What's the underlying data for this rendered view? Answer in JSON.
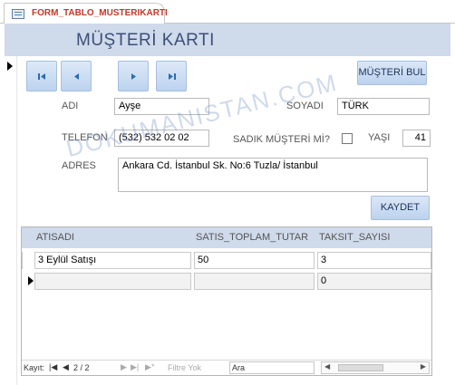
{
  "tab": {
    "title": "FORM_TABLO_MUSTERIKARTI"
  },
  "form": {
    "title": "MÜŞTERİ KARTI"
  },
  "buttons": {
    "find": "MÜŞTERİ BUL",
    "save": "KAYDET"
  },
  "fields": {
    "ad_label": "ADI",
    "ad_value": "Ayşe",
    "soyad_label": "SOYADI",
    "soyad_value": "TÜRK",
    "telefon_label": "TELEFON",
    "telefon_value": "(532) 532 02 02",
    "sadik_label": "SADIK MÜŞTERİ Mİ?",
    "yas_label": "YAŞI",
    "yas_value": "41",
    "adres_label": "ADRES",
    "adres_value": "Ankara Cd. İstanbul Sk. No:6 Tuzla/ İstanbul"
  },
  "subform": {
    "columns": [
      "ATISADI",
      "SATIS_TOPLAM_TUTAR",
      "TAKSIT_SAYISI"
    ],
    "rows": [
      {
        "a": "3 Eylül Satışı",
        "b": "50",
        "c": "3"
      }
    ],
    "new_row": {
      "c": "0"
    }
  },
  "status": {
    "record_label": "Kayıt:",
    "position": "2 / 2",
    "filter": "Filtre Yok",
    "search": "Ara"
  },
  "watermark": "DOKUMANISTAN.COM",
  "colors": {
    "header_band": "#cfdaea",
    "tab_title": "#c0392b",
    "button": "#bcd2ee"
  }
}
